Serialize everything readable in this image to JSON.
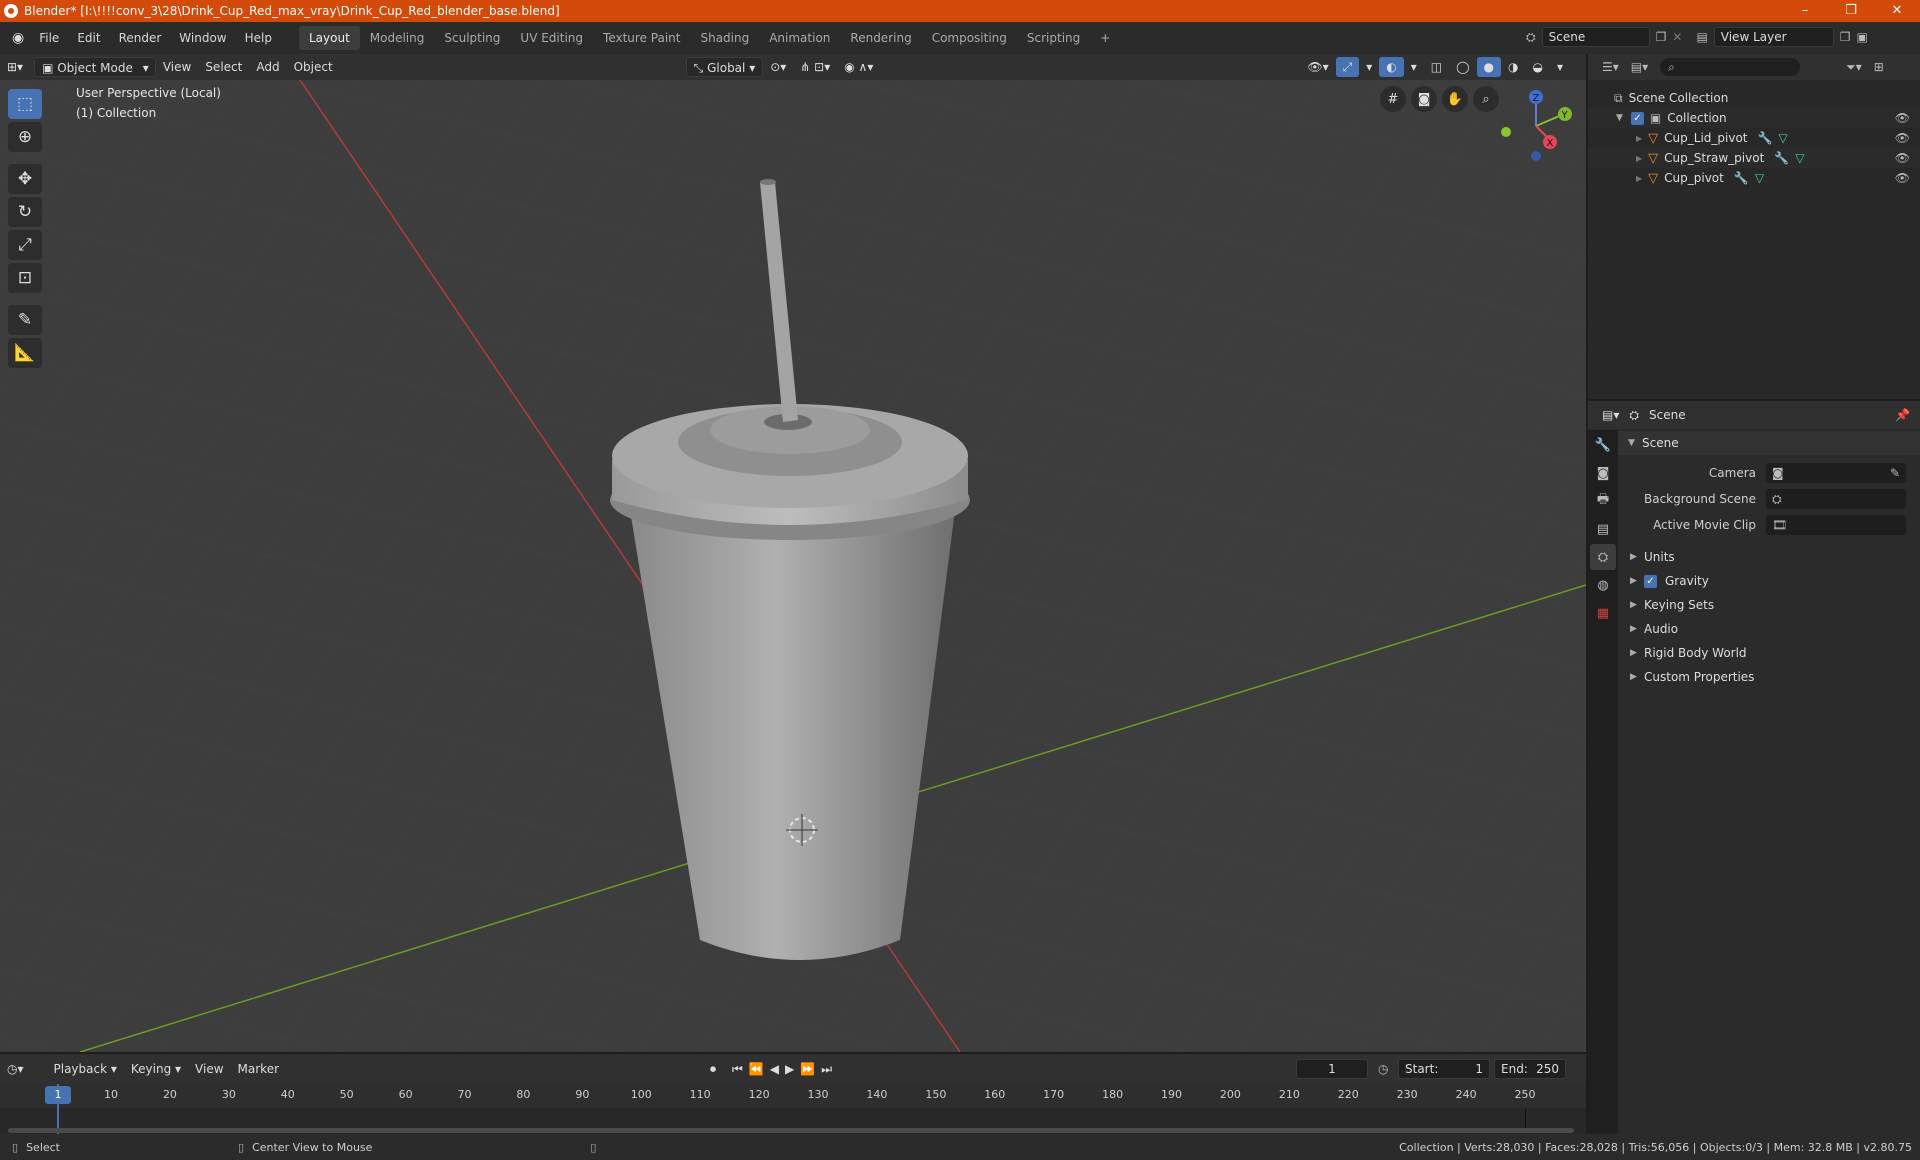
{
  "window": {
    "title": "Blender* [I:\\!!!!conv_3\\28\\Drink_Cup_Red_max_vray\\Drink_Cup_Red_blender_base.blend]",
    "controls": [
      "–",
      "❐",
      "✕"
    ]
  },
  "menu": {
    "items": [
      "File",
      "Edit",
      "Render",
      "Window",
      "Help"
    ],
    "workspaces": [
      "Layout",
      "Modeling",
      "Sculpting",
      "UV Editing",
      "Texture Paint",
      "Shading",
      "Animation",
      "Rendering",
      "Compositing",
      "Scripting"
    ],
    "active_workspace": "Layout",
    "add_tab": "+",
    "scene_value": "Scene",
    "view_layer_value": "View Layer"
  },
  "viewport_header": {
    "mode": "Object Mode",
    "menus": [
      "View",
      "Select",
      "Add",
      "Object"
    ],
    "orientation": "Global"
  },
  "viewport": {
    "perspective_label": "User Perspective (Local)",
    "collection_label": "(1) Collection",
    "gizmo_axes": {
      "x": "X",
      "y": "Y",
      "z": "Z"
    },
    "colors": {
      "x_axis": "#b33b3b",
      "y_axis": "#6e9a26",
      "active_tool": "#4772b3"
    }
  },
  "outliner": {
    "root": "Scene Collection",
    "collection": "Collection",
    "objects": [
      "Cup_Lid_pivot",
      "Cup_Straw_pivot",
      "Cup_pivot"
    ]
  },
  "properties": {
    "header": "Scene",
    "panel_title": "Scene",
    "fields": [
      {
        "label": "Camera",
        "value": ""
      },
      {
        "label": "Background Scene",
        "value": ""
      },
      {
        "label": "Active Movie Clip",
        "value": ""
      }
    ],
    "panels": [
      "Units",
      "Gravity",
      "Keying Sets",
      "Audio",
      "Rigid Body World",
      "Custom Properties"
    ],
    "gravity_checked": true
  },
  "timeline": {
    "menus": [
      "Playback",
      "Keying",
      "View",
      "Marker"
    ],
    "current_frame": "1",
    "start_label": "Start:",
    "start": "1",
    "end_label": "End:",
    "end": "250",
    "ticks": [
      "1",
      "10",
      "20",
      "30",
      "40",
      "50",
      "60",
      "70",
      "80",
      "90",
      "100",
      "110",
      "120",
      "130",
      "140",
      "150",
      "160",
      "170",
      "180",
      "190",
      "200",
      "210",
      "220",
      "230",
      "240",
      "250"
    ]
  },
  "statusbar": {
    "select": "Select",
    "center_view": "Center View to Mouse",
    "stats": "Collection | Verts:28,030 | Faces:28,028 | Tris:56,056 | Objects:0/3 | Mem: 32.8 MB | v2.80.75"
  }
}
